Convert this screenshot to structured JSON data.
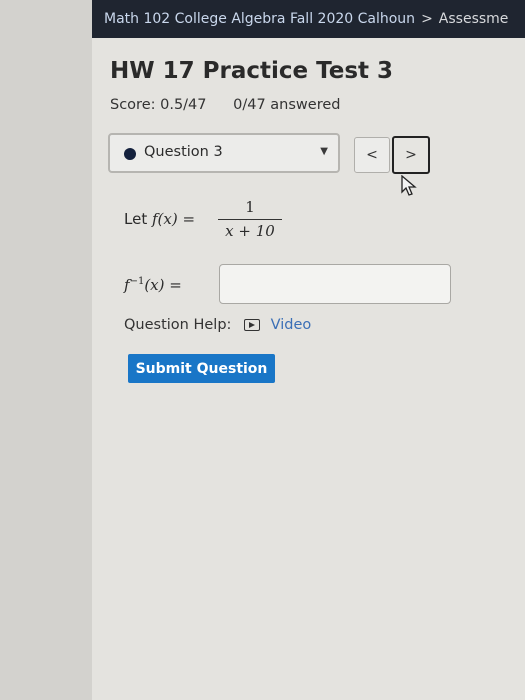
{
  "header": {
    "course": "Math 102 College Algebra Fall 2020 Calhoun",
    "separator": ">",
    "section": "Assessme"
  },
  "assessment": {
    "title": "HW 17 Practice Test 3",
    "score": "Score: 0.5/47",
    "answered": "0/47 answered"
  },
  "question_selector": {
    "selected": "Question 3",
    "prev_label": "<",
    "next_label": ">"
  },
  "question": {
    "prefix": "Let",
    "function_lhs": "f(x)",
    "equals": "=",
    "numerator": "1",
    "denominator": "x + 10",
    "answer_lhs_base": "f",
    "answer_lhs_exponent": "−1",
    "answer_lhs_arg": "(x)",
    "answer_value": ""
  },
  "help": {
    "label": "Question Help:",
    "video_label": "Video"
  },
  "submit_label": "Submit Question",
  "colors": {
    "header_bg": "#1f2530",
    "submit_bg": "#1976c7",
    "link": "#3b6fb6"
  }
}
